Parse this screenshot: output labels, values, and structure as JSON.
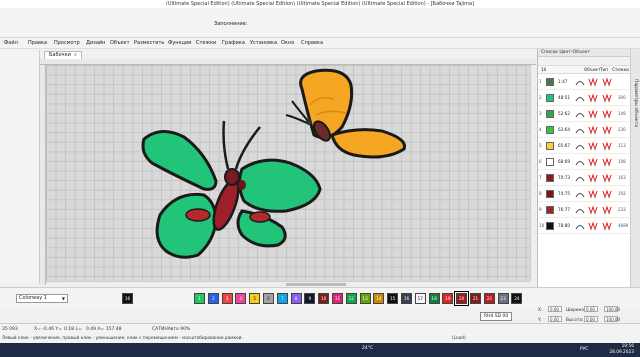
{
  "title": "(Ultimate Special Edition) (Ultimate Special Edition) (Ultimate Special Edition) (Ultimate Special Edition) - [Бабочки   Tajima]",
  "fill_label": "Заполнение:",
  "menu": [
    "Файл",
    "Правка",
    "Просмотр",
    "Дизайн",
    "Объект",
    "Разместить",
    "Функции",
    "Стежки",
    "Графика",
    "Установка",
    "Окно",
    "Справка"
  ],
  "tab": {
    "label": "Бабочки",
    "close": "x"
  },
  "panel": {
    "title": "Список Цвет-Объект",
    "side_tab": "Параметры объекта",
    "columns": [
      "10",
      "",
      "Объект",
      "Тип",
      "Стежки"
    ],
    "rows": [
      {
        "num": "1",
        "count": "1:47",
        "color": "#4a7a4a",
        "flag": ""
      },
      {
        "num": "2",
        "count": "48:51",
        "color": "#22c47a",
        "flag": "300"
      },
      {
        "num": "3",
        "count": "52:62",
        "color": "#2fa84a",
        "flag": "149"
      },
      {
        "num": "4",
        "count": "63:64",
        "color": "#3fbf3f",
        "flag": "230"
      },
      {
        "num": "5",
        "count": "65:67",
        "color": "#f6d23a",
        "flag": "113"
      },
      {
        "num": "6",
        "count": "68:69",
        "color": "#ffffff",
        "flag": "108"
      },
      {
        "num": "7",
        "count": "70:73",
        "color": "#8b1c1c",
        "flag": "163"
      },
      {
        "num": "8",
        "count": "74:75",
        "color": "#7a1717",
        "flag": "192"
      },
      {
        "num": "9",
        "count": "76:77",
        "color": "#9a2828",
        "flag": "233"
      },
      {
        "num": "10",
        "count": "78:80",
        "color": "#111111",
        "flag": "4689"
      }
    ]
  },
  "colorway": "Colorway 1",
  "palette": [
    {
      "n": "16",
      "c": "#111111"
    },
    {
      "n": "1",
      "c": "#22c55e"
    },
    {
      "n": "2",
      "c": "#2563eb"
    },
    {
      "n": "3",
      "c": "#ef4444"
    },
    {
      "n": "4",
      "c": "#ec4899"
    },
    {
      "n": "5",
      "c": "#facc15"
    },
    {
      "n": "6",
      "c": "#a3a3a3"
    },
    {
      "n": "7",
      "c": "#0ea5e9"
    },
    {
      "n": "8",
      "c": "#8b5cf6"
    },
    {
      "n": "9",
      "c": "#111827"
    },
    {
      "n": "10",
      "c": "#7f1d1d"
    },
    {
      "n": "11",
      "c": "#db2777"
    },
    {
      "n": "12",
      "c": "#16a34a"
    },
    {
      "n": "13",
      "c": "#65a30d"
    },
    {
      "n": "14",
      "c": "#ca8a04"
    },
    {
      "n": "15",
      "c": "#111111"
    },
    {
      "n": "16",
      "c": "#374151"
    },
    {
      "n": "17",
      "c": "#f5f5f5"
    },
    {
      "n": "18",
      "c": "#15803d"
    },
    {
      "n": "19",
      "c": "#dc2626"
    },
    {
      "n": "20",
      "c": "#991b1b"
    },
    {
      "n": "21",
      "c": "#7f1d1d"
    },
    {
      "n": "22",
      "c": "#b91c1c"
    },
    {
      "n": "23",
      "c": "#6b7280"
    },
    {
      "n": "24",
      "c": "#111111"
    }
  ],
  "tooltip": "RH4 SD 00",
  "props": {
    "x_label": "X:",
    "x_value": "0.00",
    "y_label": "Y:",
    "y_value": "0.00",
    "w_label": "Ширина:",
    "w_value": "0.00",
    "h_label": "Высота:",
    "h_value": "0.00",
    "pct1": "100.00",
    "pct2": "100.00"
  },
  "status": {
    "stitches": "35 093",
    "x": "X= -0.46 Y=",
    "y": "0.18 L=",
    "l": "0.49 A= 157.48",
    "mode": "САТИНАвто 90%"
  },
  "hint": "Левый клик - увеличение, правый клик - уменьшение, клик с перемещением - масштабирование рамкой.",
  "hint_right": "(Load)",
  "taskbar": {
    "weather": "24°C",
    "time": "10:56",
    "date": "28.09.2023",
    "lang": "РУС"
  }
}
